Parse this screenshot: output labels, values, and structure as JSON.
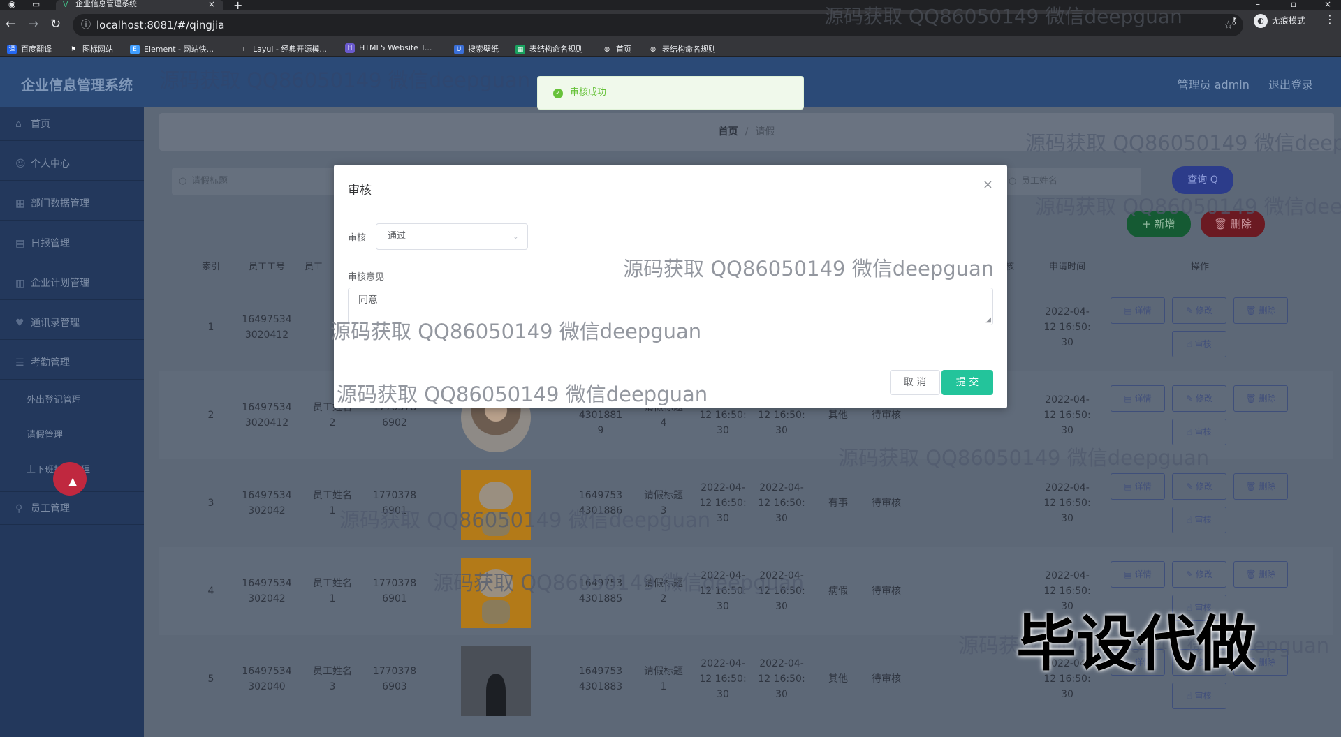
{
  "browser": {
    "tab_title": "企业信息管理系统",
    "url": "localhost:8081/#/qingjia",
    "incognito_label": "无痕模式",
    "bookmarks": [
      "百度翻译",
      "图标网站",
      "Element - 网站快...",
      "Layui - 经典开源模...",
      "HTML5 Website T...",
      "搜索壁纸",
      "表结构命名规则",
      "首页",
      "表结构命名规则"
    ]
  },
  "header": {
    "brand": "企业信息管理系统",
    "user": "管理员 admin",
    "logout": "退出登录"
  },
  "sidebar": {
    "items": [
      "首页",
      "个人中心",
      "部门数据管理",
      "日报管理",
      "企业计划管理",
      "通讯录管理",
      "考勤管理"
    ],
    "subitems": [
      "外出登记管理",
      "请假管理",
      "上下班打卡管理"
    ],
    "last_item": "员工管理"
  },
  "breadcrumb": {
    "home": "首页",
    "sep": "/",
    "current": "请假"
  },
  "search": {
    "placeholder_title": "请假标题",
    "placeholder_name": "员工姓名",
    "query_button": "查询 Q"
  },
  "actions": {
    "add": "+ 新增",
    "delete": "删除"
  },
  "table": {
    "headers": [
      "索引",
      "员工工号",
      "员工",
      "审核回复",
      "申请时间",
      "操作"
    ],
    "rows": [
      {
        "index": "1",
        "staff_no": "16497534\n3020412",
        "name": "",
        "phone": "",
        "leave_no": "",
        "leave_title": "",
        "start": "",
        "end": "",
        "type": "",
        "status": "",
        "apply_time": "2022-04-\n12 16:50:\n30",
        "photo": "none"
      },
      {
        "index": "2",
        "staff_no": "16497534\n3020412",
        "name": "员工姓名\n2",
        "phone": "1770378\n6902",
        "leave_no": "1649753\n4301881\n9",
        "leave_title": "请假标题\n4",
        "start": "2022-04-\n12 16:50:\n30",
        "end": "2022-04-\n12 16:50:\n30",
        "type": "其他",
        "status": "待审核",
        "apply_time": "2022-04-\n12 16:50:\n30",
        "photo": "round"
      },
      {
        "index": "3",
        "staff_no": "16497534\n302042",
        "name": "员工姓名\n1",
        "phone": "1770378\n6901",
        "leave_no": "1649753\n4301886",
        "leave_title": "请假标题\n3",
        "start": "2022-04-\n12 16:50:\n30",
        "end": "2022-04-\n12 16:50:\n30",
        "type": "有事",
        "status": "待审核",
        "apply_time": "2022-04-\n12 16:50:\n30",
        "photo": "cartoon"
      },
      {
        "index": "4",
        "staff_no": "16497534\n302042",
        "name": "员工姓名\n1",
        "phone": "1770378\n6901",
        "leave_no": "1649753\n4301885",
        "leave_title": "请假标题\n2",
        "start": "2022-04-\n12 16:50:\n30",
        "end": "2022-04-\n12 16:50:\n30",
        "type": "病假",
        "status": "待审核",
        "apply_time": "2022-04-\n12 16:50:\n30",
        "photo": "cartoon"
      },
      {
        "index": "5",
        "staff_no": "16497534\n302040",
        "name": "员工姓名\n3",
        "phone": "1770378\n6903",
        "leave_no": "1649753\n4301883",
        "leave_title": "请假标题\n1",
        "start": "2022-04-\n12 16:50:\n30",
        "end": "2022-04-\n12 16:50:\n30",
        "type": "其他",
        "status": "待审核",
        "apply_time": "2022-04-\n12 16:50:\n30",
        "photo": "dark"
      }
    ],
    "row_buttons": {
      "detail": "详情",
      "edit": "修改",
      "delete": "删除",
      "review": "审核"
    }
  },
  "dialog": {
    "title": "审核",
    "review_label": "审核",
    "review_value": "通过",
    "opinion_label": "审核意见",
    "opinion_value": "同意",
    "cancel": "取 消",
    "submit": "提 交"
  },
  "toast": {
    "message": "审核成功"
  },
  "watermark": {
    "text": "源码获取 QQ86050149 微信deepguan",
    "big": "毕设代做"
  },
  "colors": {
    "accent": "#23c49b",
    "success": "#67c23a",
    "header": "#2b4a77"
  }
}
